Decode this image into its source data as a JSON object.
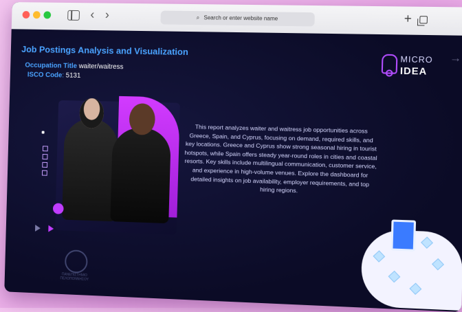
{
  "browser": {
    "url_placeholder": "Search or enter website name"
  },
  "page": {
    "title": "Job Postings Analysis and Visualization",
    "occupation_label": "Occupation Title",
    "occupation_value": "waiter/waitress",
    "isco_label": "ISCO Code",
    "isco_value": "5131",
    "logo_top": "MICRO",
    "logo_bottom": "IDEA",
    "description": "This report analyzes waiter and waitress job opportunities across Greece, Spain, and Cyprus, focusing on demand, required skills, and key locations. Greece and Cyprus show strong seasonal hiring in tourist hotspots, while Spain offers steady year-round roles in cities and coastal resorts. Key skills include multilingual communication, customer service, and experience in high-volume venues. Explore the dashboard for detailed insights on job availability, employer requirements, and top hiring regions.",
    "seal_text": "ΠΑΝΕΠΙΣΤΗΜΙΟ ΠΕΛΟΠΟΝΝΗΣΟΥ"
  },
  "colors": {
    "accent_blue": "#4aa3ff",
    "accent_purple": "#c03cff",
    "page_bg": "#0c0d2a"
  },
  "icons": {
    "window_controls": [
      "close-dot",
      "minimize-dot",
      "zoom-dot"
    ],
    "toolbar": [
      "sidebar-icon",
      "back-icon",
      "forward-icon",
      "search-icon",
      "new-tab-icon",
      "tabs-overview-icon"
    ],
    "page": [
      "next-arrow-icon",
      "play-icon"
    ]
  }
}
